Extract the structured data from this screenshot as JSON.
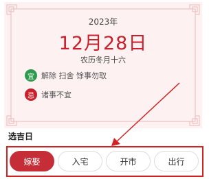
{
  "almanac": {
    "year": "2023年",
    "date": "12月28日",
    "lunar": "农历冬月十六",
    "yi": {
      "badge": "宜",
      "text": "解除 扫舍 馀事勿取"
    },
    "ji": {
      "badge": "忌",
      "text": "诸事不宜"
    }
  },
  "section_title": "选吉日",
  "options": [
    {
      "label": "嫁娶",
      "selected": true
    },
    {
      "label": "入宅",
      "selected": false
    },
    {
      "label": "开市",
      "selected": false
    },
    {
      "label": "出行",
      "selected": false
    }
  ],
  "colors": {
    "primary_red": "#c52e36",
    "card_bg": "#fdf1f1",
    "yi_green": "#2e9a4e",
    "ji_red": "#c8202c",
    "highlight": "#d32222"
  }
}
